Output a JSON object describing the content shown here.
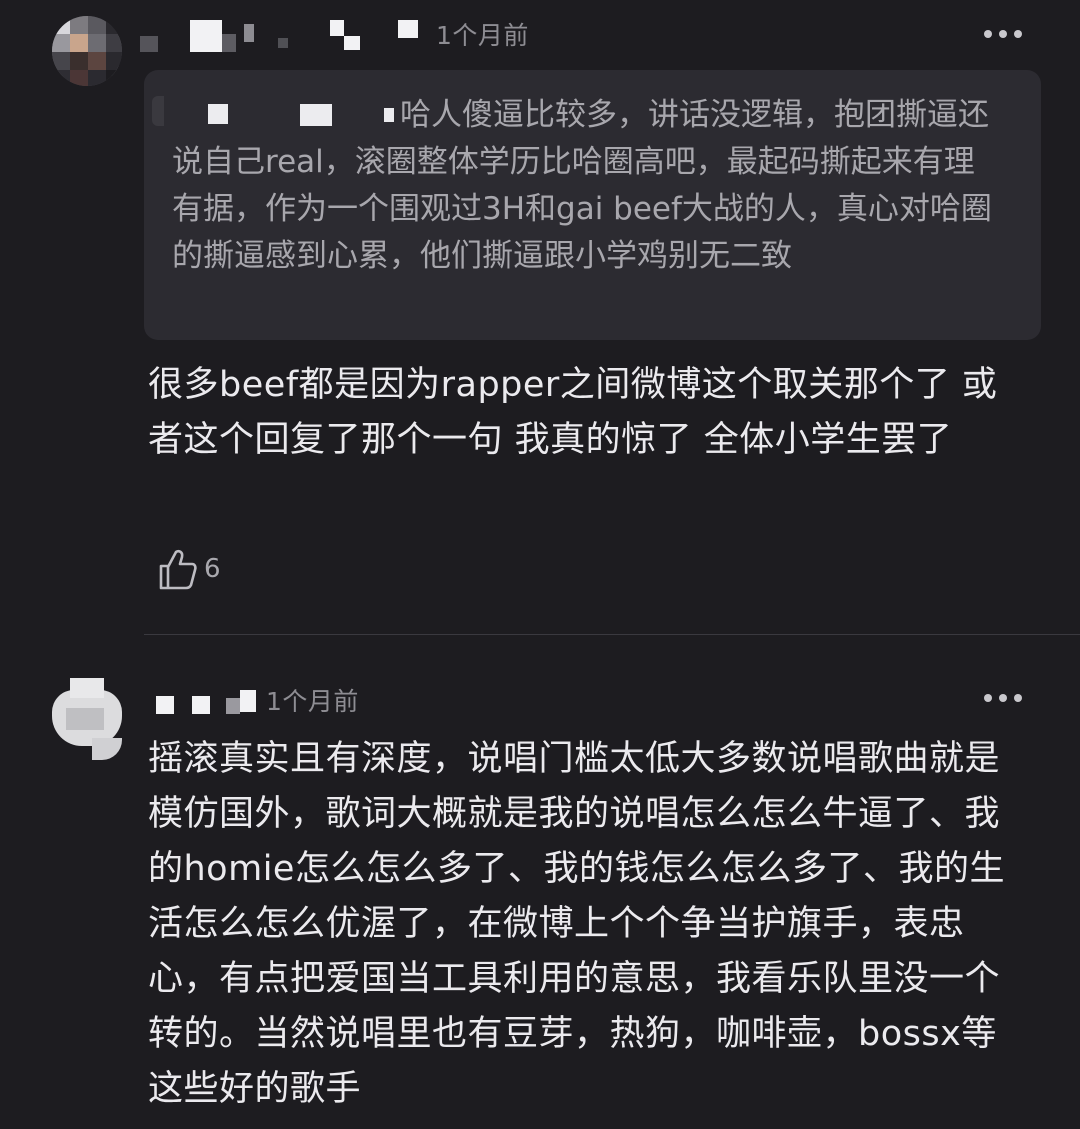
{
  "comments": [
    {
      "time": "1个月前",
      "quote": "哈人傻逼比较多，讲话没逻辑，抱团撕逼还说自己real，滚圈整体学历比哈圈高吧，最起码撕起来有理有据，作为一个围观过3H和gai beef大战的人，真心对哈圈的撕逼感到心累，他们撕逼跟小学鸡别无二致",
      "body": "很多beef都是因为rapper之间微博这个取关那个了 或者这个回复了那个一句 我真的惊了 全体小学生罢了",
      "likes": "6"
    },
    {
      "time": "1个月前",
      "body": "摇滚真实且有深度，说唱门槛太低大多数说唱歌曲就是模仿国外，歌词大概就是我的说唱怎么怎么牛逼了、我的homie怎么怎么多了、我的钱怎么怎么多了、我的生活怎么怎么优渥了，在微博上个个争当护旗手，表忠心，有点把爱国当工具利用的意思，我看乐队里没一个转的。当然说唱里也有豆芽，热狗，咖啡壶，bossx等这些好的歌手"
    }
  ],
  "icons": {
    "more": "more-dots-icon",
    "like": "thumbs-up-icon"
  },
  "colors": {
    "background": "#1d1c20",
    "quote_background": "#2c2b31",
    "text": "#ebeaee",
    "muted": "#8e8d93"
  }
}
